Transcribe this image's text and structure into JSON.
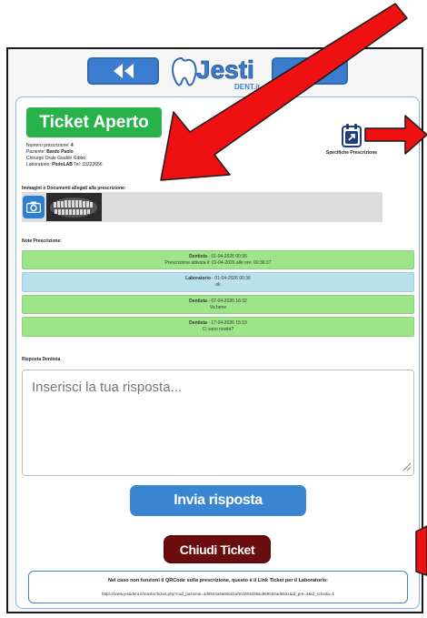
{
  "header": {
    "back_icon": "double-chevron-left-icon",
    "logo_text": "Jesti",
    "logo_suffix": "DENT.it"
  },
  "ticket": {
    "status_label": "Ticket Aperto",
    "status_color": "#27b34a",
    "prescription_label": "Numero prescrizione:",
    "prescription_number": "4",
    "patient_label": "Paziente:",
    "patient_name": "Bardo Paolo",
    "procedure": "Chirurgo Orale Giaddo Gibbo",
    "lab_label": "Laboratorio:",
    "lab_name": "PlutoLAB",
    "lab_phone": "Tel: 33222656"
  },
  "specs": {
    "icon": "calendar-arrow-icon",
    "label": "Specifiche Prescrizione"
  },
  "attachments": {
    "label": "Immagini o Documenti allegati alla prescrizione:",
    "camera_icon": "camera-icon"
  },
  "notes": {
    "label": "Note Prescrizione:",
    "items": [
      {
        "author": "Dentista",
        "date": " - 01-04-2026 00:36",
        "text": "Prescrizione attivata il: 01-04-2026 alle ore: 00:36:37",
        "color": "green"
      },
      {
        "author": "Laboratorio",
        "date": " - 01-04-2026 00:36",
        "text": "ok",
        "color": "blue"
      },
      {
        "author": "Dentista",
        "date": " - 07-04-2026 16:32",
        "text": "Va bene",
        "color": "green"
      },
      {
        "author": "Dentista",
        "date": " - 17-04-2026 15:10",
        "text": "Ci sono novità?",
        "color": "green"
      }
    ]
  },
  "reply": {
    "label": "Risposta Dentista",
    "placeholder": "Inserisci la tua risposta...",
    "send_label": "Invia risposta",
    "close_label": "Chiudi Ticket"
  },
  "footer": {
    "note": "Nel caso non funzioni il QRCode sulla prescrizione, questo è il Link Ticket per il Laboratorio:",
    "url": "https://www.jestident.it/master/ticket.php?cod_paziente=1d9924a9a60ed1af81f283d38ac669933ad6531&id_pre=4&id_scheda=1"
  },
  "colors": {
    "primary": "#3b86d2",
    "danger_dark": "#6b0d0d",
    "note_green": "#9ee58a",
    "note_blue": "#b8e1ec",
    "annotation_red": "#ef1111"
  }
}
